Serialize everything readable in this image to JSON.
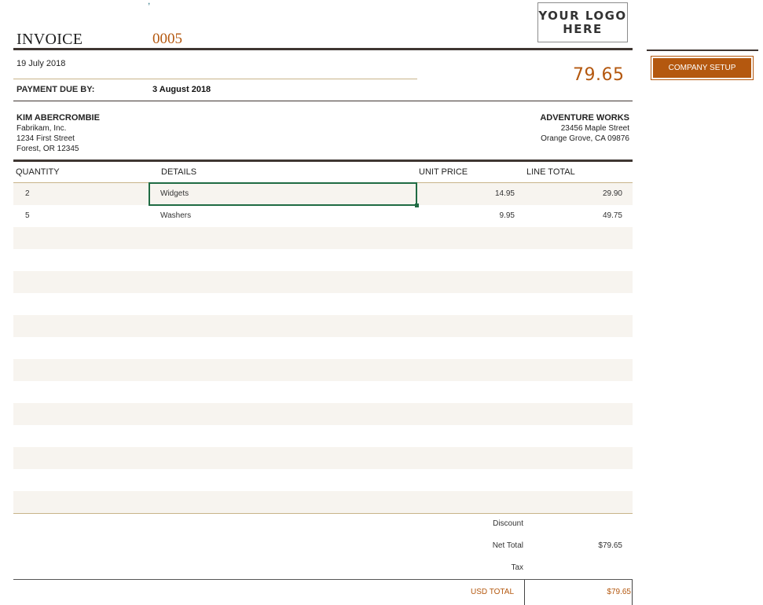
{
  "top_mark": ",",
  "invoice": {
    "title": "INVOICE",
    "number": "0005",
    "date": "19 July 2018",
    "total_due": "79.65",
    "due_label": "PAYMENT DUE BY:",
    "due_value": "3 August 2018"
  },
  "logo": {
    "line1": "YOUR LOGO",
    "line2": "HERE"
  },
  "bill_to": {
    "name": "KIM ABERCROMBIE",
    "line1": "Fabrikam, Inc.",
    "line2": "1234 First Street",
    "line3": "Forest, OR 12345"
  },
  "from": {
    "name": "ADVENTURE WORKS",
    "line1": "23456 Maple Street",
    "line2": "Orange Grove, CA 09876"
  },
  "columns": {
    "quantity": "QUANTITY",
    "details": "DETAILS",
    "unit_price": "UNIT PRICE",
    "line_total": "LINE TOTAL"
  },
  "items": [
    {
      "qty": "2",
      "details": "Widgets",
      "unit_price": "14.95",
      "line_total": "29.90"
    },
    {
      "qty": "5",
      "details": "Washers",
      "unit_price": "9.95",
      "line_total": "49.75"
    }
  ],
  "summary": {
    "discount_label": "Discount",
    "net_total_label": "Net Total",
    "net_total_value": "$79.65",
    "tax_label": "Tax",
    "usd_total_label": "USD TOTAL",
    "usd_total_value": "$79.65"
  },
  "buttons": {
    "company_setup": "COMPANY SETUP"
  },
  "colors": {
    "accent": "#b4580f",
    "rule": "#3f3632",
    "shade": "#f7f4ef",
    "selection": "#1f6b43"
  }
}
